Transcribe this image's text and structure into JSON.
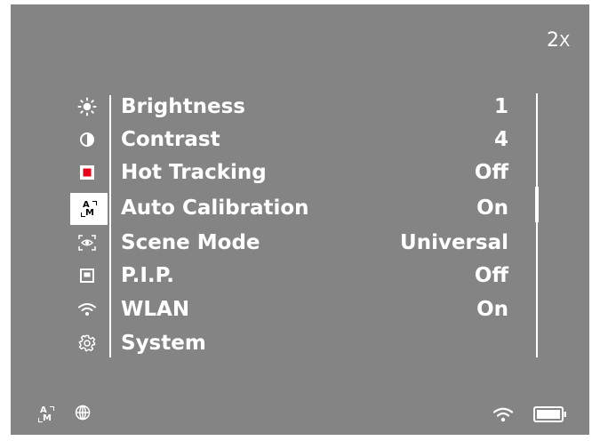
{
  "zoom": {
    "value": "2",
    "suffix": "X"
  },
  "menu": {
    "items": [
      {
        "label": "Brightness",
        "value": "1",
        "icon": "brightness-icon"
      },
      {
        "label": "Contrast",
        "value": "4",
        "icon": "contrast-icon"
      },
      {
        "label": "Hot Tracking",
        "value": "Off",
        "icon": "hot-tracking-icon"
      },
      {
        "label": "Auto Calibration",
        "value": "On",
        "icon": "auto-calibration-icon",
        "selected": true
      },
      {
        "label": "Scene Mode",
        "value": "Universal",
        "icon": "scene-mode-icon"
      },
      {
        "label": "P.I.P.",
        "value": "Off",
        "icon": "pip-icon"
      },
      {
        "label": "WLAN",
        "value": "On",
        "icon": "wifi-icon"
      },
      {
        "label": "System",
        "value": "",
        "icon": "gear-icon"
      }
    ]
  },
  "status": {
    "left_icons": [
      "auto-calibration-icon",
      "globe-icon"
    ],
    "right_icons": [
      "wifi-icon",
      "battery-icon"
    ]
  },
  "colors": {
    "screen_bg": "#848484",
    "foreground": "#ffffff",
    "hot_tracking": "#e8001a"
  },
  "am_icon": {
    "top": "A",
    "bottom": "M"
  }
}
